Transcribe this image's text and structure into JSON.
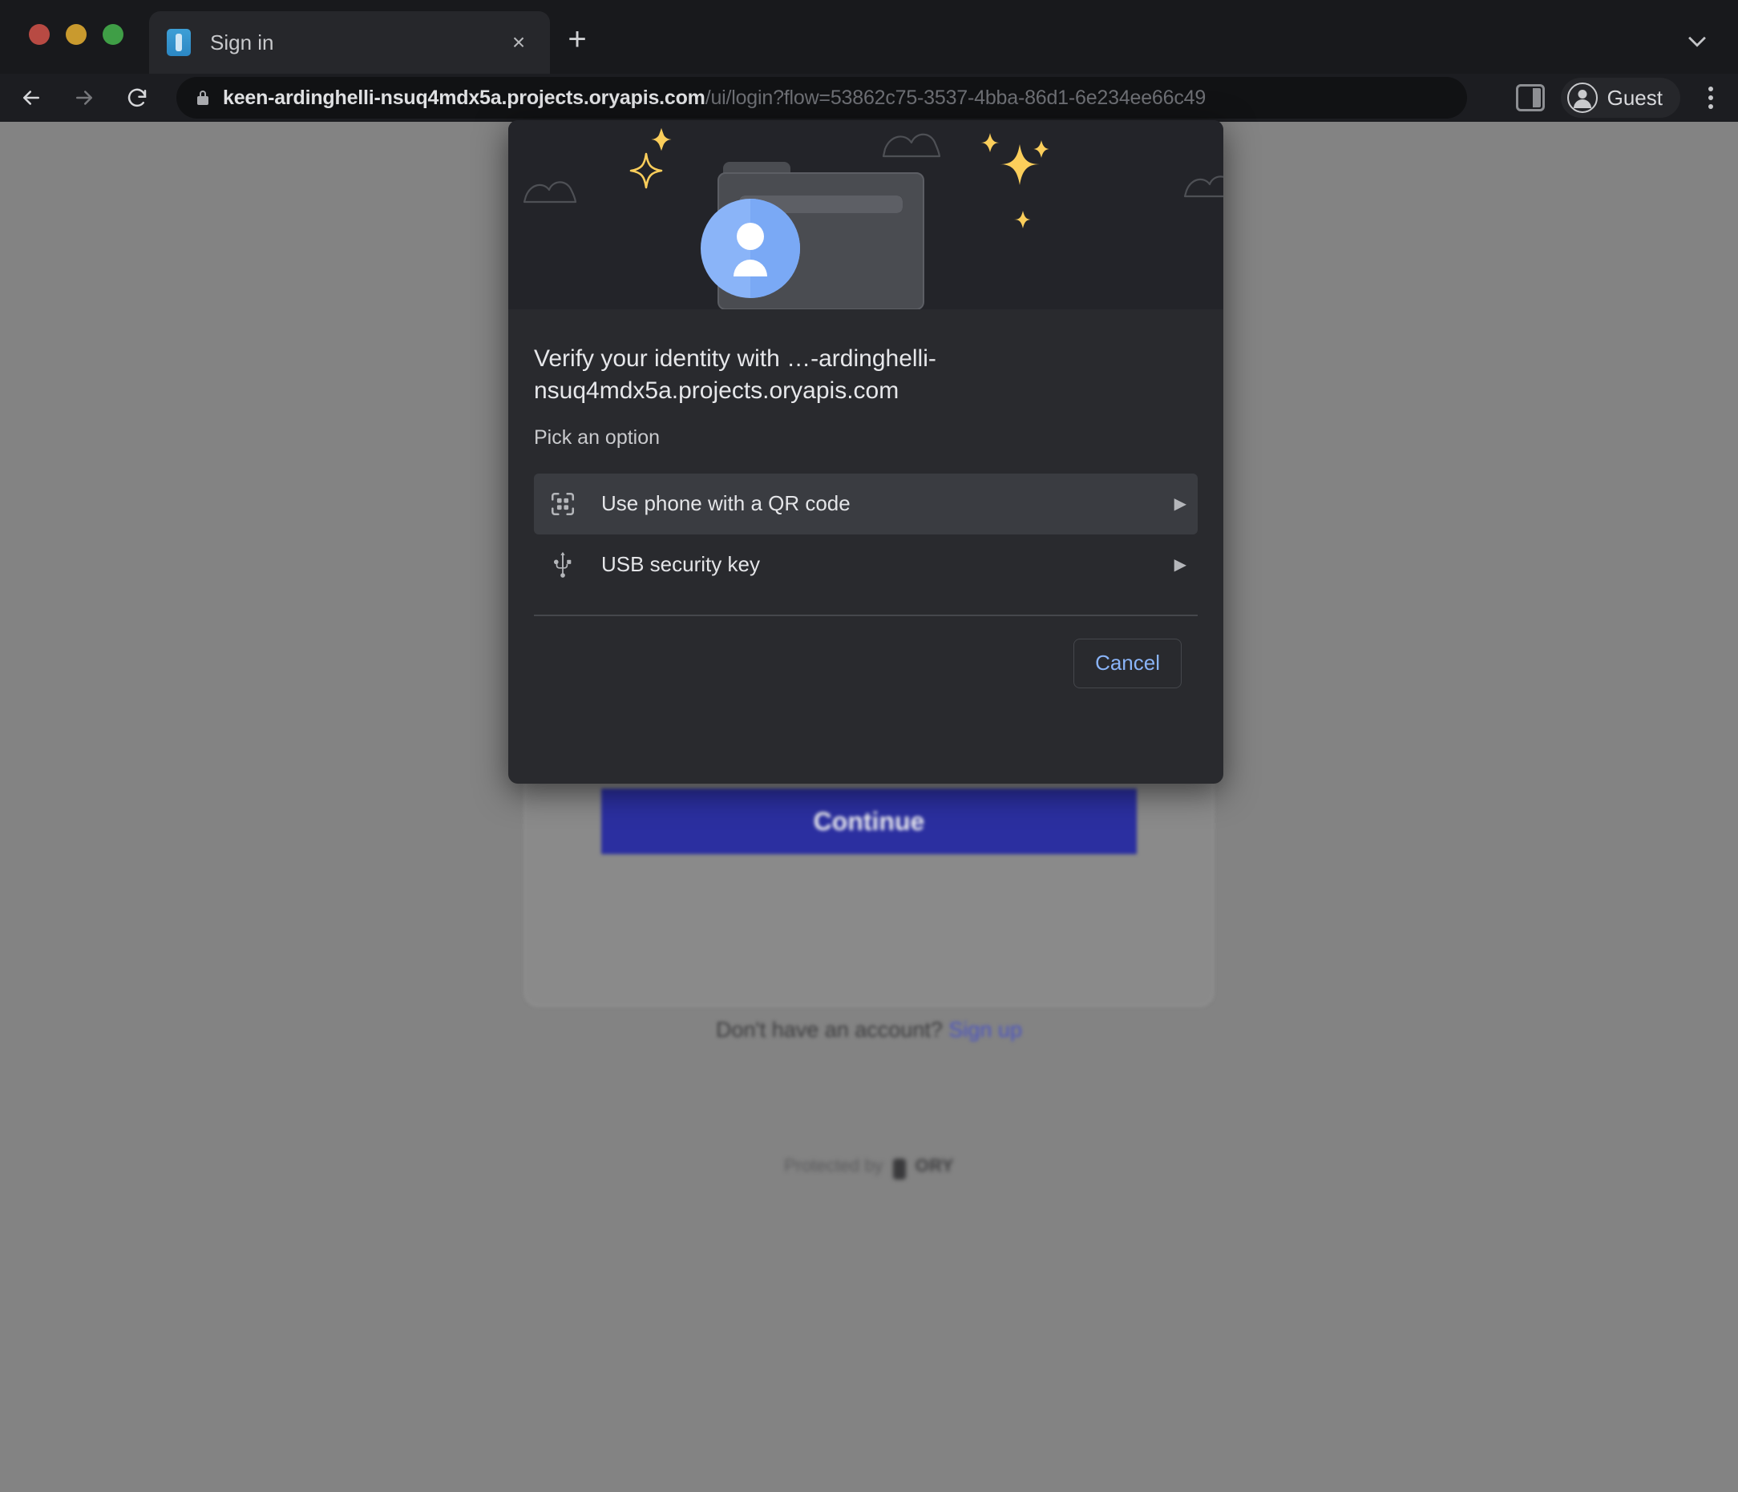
{
  "browser": {
    "tab": {
      "title": "Sign in",
      "favicon": "sign-in-favicon",
      "close_label": "×"
    },
    "new_tab_label": "+",
    "tab_list_chevron": "chevron-down-icon",
    "toolbar": {
      "back": "back-arrow-icon",
      "forward": "forward-arrow-icon",
      "reload": "reload-icon",
      "lock": "lock-icon",
      "url_host": "keen-ardinghelli-nsuq4mdx5a.projects.oryapis.com",
      "url_path": "/ui/login?flow=53862c75-3537-4bba-86d1-6e234ee66c49",
      "side_panel": "side-panel-icon",
      "profile_label": "Guest",
      "profile_avatar": "account-circle-icon",
      "menu": "kebab-menu-icon"
    }
  },
  "page": {
    "continue_button": "Continue",
    "signup_prompt": "Don't have an account?",
    "signup_link": "Sign up",
    "footer_prefix": "Protected by",
    "footer_brand": "ORY"
  },
  "dialog": {
    "hero_illustration": "passkey-folder-illustration",
    "title": "Verify your identity with …-ardinghelli-nsuq4mdx5a.projects.oryapis.com",
    "subtitle": "Pick an option",
    "options": [
      {
        "label": "Use phone with a QR code",
        "icon": "qr-code-icon",
        "arrow": "▶",
        "selected": true
      },
      {
        "label": "USB security key",
        "icon": "usb-icon",
        "arrow": "▶",
        "selected": false
      }
    ],
    "cancel_label": "Cancel"
  },
  "colors": {
    "dialog_bg": "#292a2e",
    "dialog_hero_bg": "#232429",
    "selected_row": "#3a3c41",
    "accent_link": "#8ab4f8",
    "continue_bg": "#2b2fa0",
    "avatar_blue": "#8ab4f8",
    "sparkle_yellow": "#fbce5b"
  }
}
